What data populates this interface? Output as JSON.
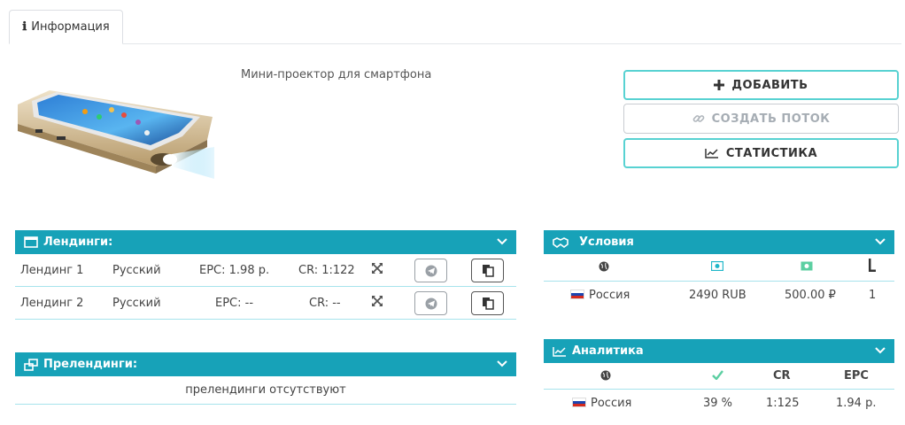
{
  "tabs": [
    {
      "label": "Информация"
    }
  ],
  "product": {
    "title": "Мини-проектор для смартфона"
  },
  "actions": {
    "add_label": "ДОБАВИТЬ",
    "create_flow_label": "СОЗДАТЬ ПОТОК",
    "stats_label": "СТАТИСТИКА"
  },
  "landings": {
    "title": "Лендинги:",
    "rows": [
      {
        "name": "Лендинг 1",
        "language": "Русский",
        "epc": "EPC: 1.98 р.",
        "cr": "CR: 1:122"
      },
      {
        "name": "Лендинг 2",
        "language": "Русский",
        "epc": "EPC: --",
        "cr": "CR: --"
      }
    ]
  },
  "prelandings": {
    "title": "Прелендинги:",
    "empty_text": "прелендинги отсутствуют"
  },
  "conditions": {
    "title": "Условия",
    "row": {
      "country": "Россия",
      "price": "2490 RUB",
      "payout": "500.00 ₽",
      "limit": "1"
    }
  },
  "analytics": {
    "title": "Аналитика",
    "headers": {
      "cr": "CR",
      "epc": "EPC"
    },
    "row": {
      "country": "Россия",
      "approve": "39 %",
      "cr": "1:125",
      "epc": "1.94 р."
    }
  },
  "colors": {
    "accent": "#17a2b8",
    "border_accent": "#58d2d2",
    "approve_icon": "#5ccfa2",
    "money_icon": "#1fb7c9"
  }
}
